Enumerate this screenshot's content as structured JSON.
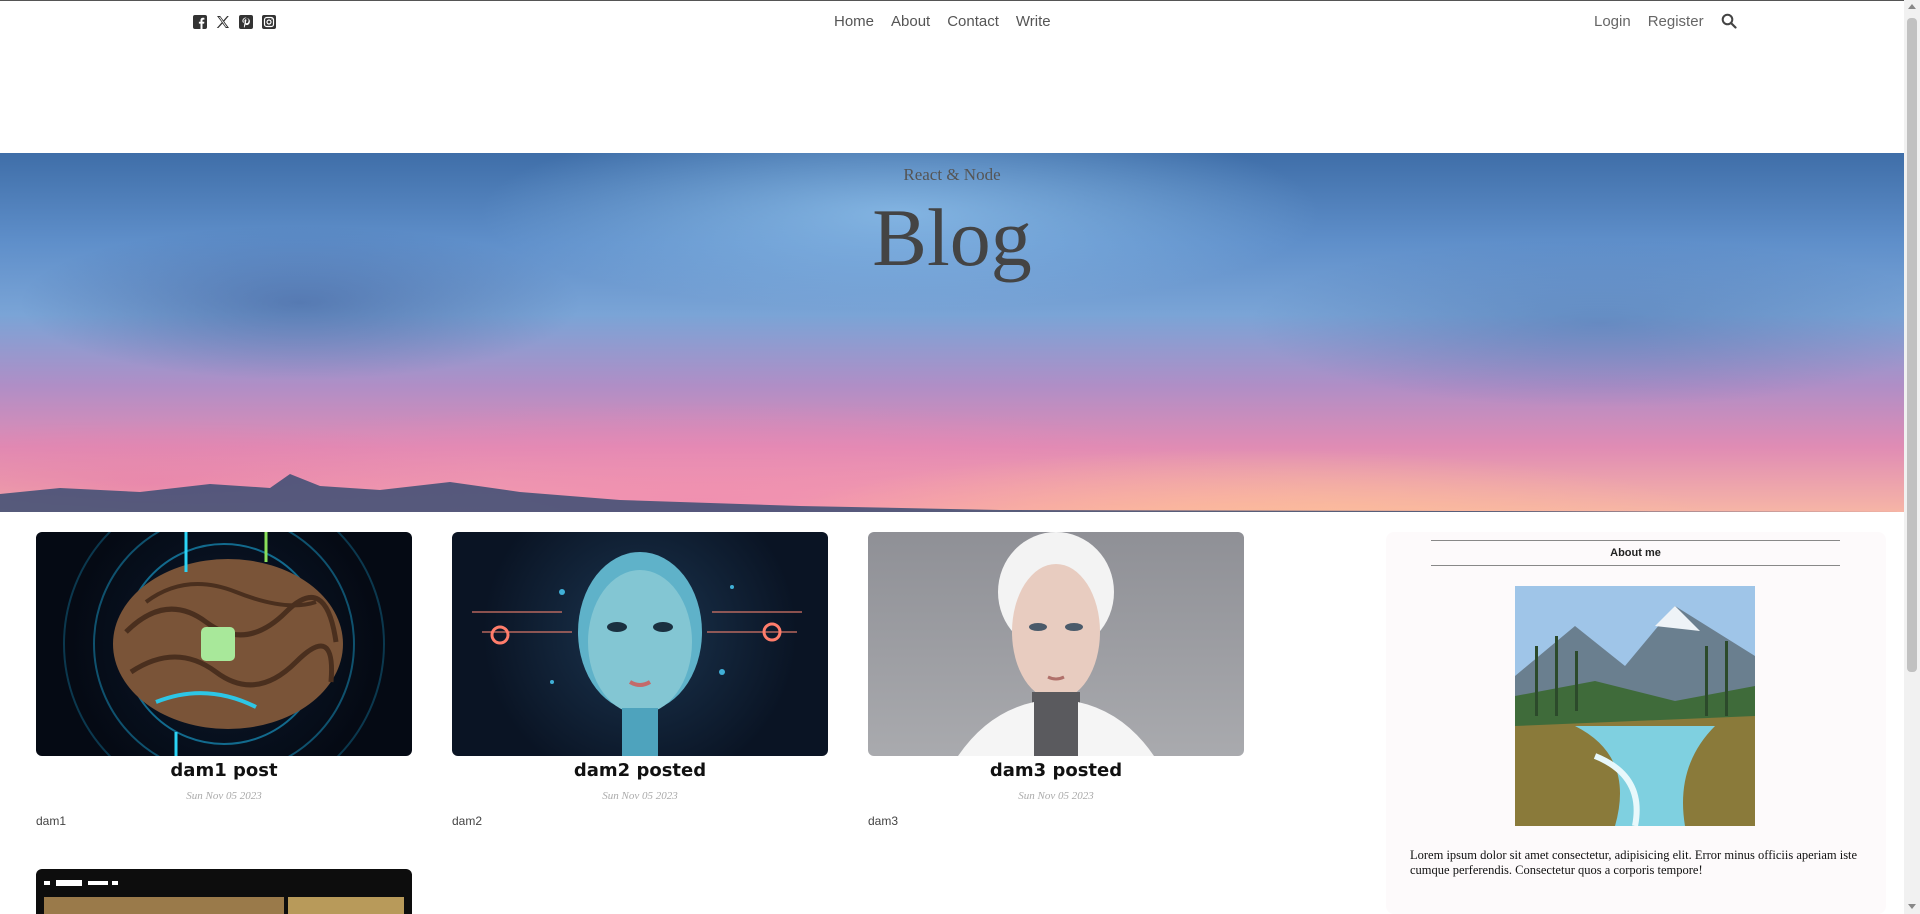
{
  "topbar": {
    "social_icons": [
      "facebook-icon",
      "x-twitter-icon",
      "pinterest-icon",
      "instagram-icon"
    ],
    "nav": [
      "Home",
      "About",
      "Contact",
      "Write"
    ],
    "auth": [
      "Login",
      "Register"
    ],
    "search_icon": "search-icon"
  },
  "hero": {
    "subtitle": "React & Node",
    "title": "Blog"
  },
  "posts": [
    {
      "title": "dam1 post",
      "date": "Sun Nov 05 2023",
      "desc": "dam1"
    },
    {
      "title": "dam2 posted",
      "date": "Sun Nov 05 2023",
      "desc": "dam2"
    },
    {
      "title": "dam3 posted",
      "date": "Sun Nov 05 2023",
      "desc": "dam3"
    },
    {
      "title": "",
      "date": "",
      "desc": ""
    }
  ],
  "sidebar": {
    "about_title": "About me",
    "about_text": "Lorem ipsum dolor sit amet consectetur, adipisicing elit. Error minus officiis aperiam iste cumque perferendis. Consectetur quos a corporis tempore!"
  },
  "colors": {
    "text": "#444444",
    "title": "#111111",
    "date": "#aaaaaa",
    "sidebar_bg": "#fdfafb"
  }
}
